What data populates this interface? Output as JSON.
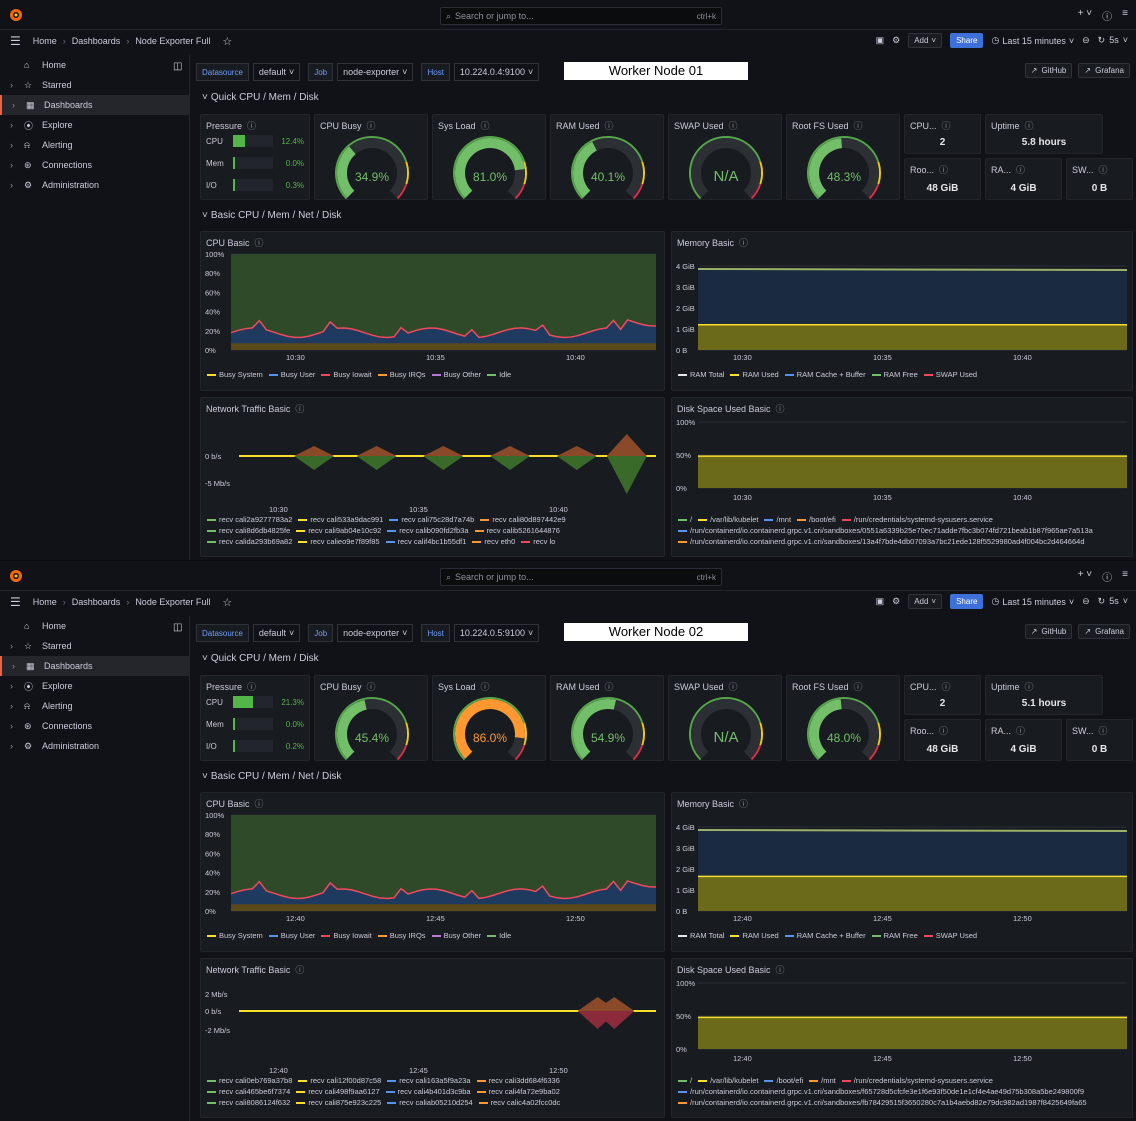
{
  "search": {
    "placeholder": "Search or jump to...",
    "shortcut": "ctrl+k"
  },
  "breadcrumb": [
    "Home",
    "Dashboards",
    "Node Exporter Full"
  ],
  "toolbar": {
    "add": "Add",
    "share": "Share",
    "time": "Last 15 minutes",
    "refresh": "5s"
  },
  "sidebar": [
    "Home",
    "Starred",
    "Dashboards",
    "Explore",
    "Alerting",
    "Connections",
    "Administration"
  ],
  "vars": {
    "datasource_label": "Datasource",
    "datasource": "default",
    "job_label": "Job",
    "job": "node-exporter",
    "host_label": "Host"
  },
  "links": {
    "github": "GitHub",
    "grafana": "Grafana"
  },
  "rows": {
    "quick": "Quick CPU / Mem / Disk",
    "basic": "Basic CPU / Mem / Net / Disk"
  },
  "panel_titles": {
    "pressure": "Pressure",
    "cpu_busy": "CPU Busy",
    "sys_load": "Sys Load",
    "ram_used": "RAM Used",
    "swap_used": "SWAP Used",
    "rootfs_used": "Root FS Used",
    "cpu_cores": "CPU...",
    "uptime": "Uptime",
    "rootfs_total": "Roo...",
    "ram_total": "RA...",
    "swap_total": "SW...",
    "cpu_basic": "CPU Basic",
    "mem_basic": "Memory Basic",
    "net_basic": "Network Traffic Basic",
    "disk_basic": "Disk Space Used Basic"
  },
  "pressure_labels": [
    "CPU",
    "Mem",
    "I/O"
  ],
  "cpu_legend": [
    "Busy System",
    "Busy User",
    "Busy Iowait",
    "Busy IRQs",
    "Busy Other",
    "Idle"
  ],
  "mem_legend": [
    "RAM Total",
    "RAM Used",
    "RAM Cache + Buffer",
    "RAM Free",
    "SWAP Used"
  ],
  "colors": {
    "green": "#73bf69",
    "yellow": "#fade2a",
    "blue": "#5794f2",
    "orange": "#ff9830",
    "red": "#f2495c",
    "purple": "#b877d9",
    "idle": "#56a64b"
  },
  "nodes": [
    {
      "host": "10.224.0.4:9100",
      "name": "Worker Node 01",
      "pressure": [
        12.4,
        0.0,
        0.3
      ],
      "pressure_text": [
        "12.4%",
        "0.0%",
        "0.3%"
      ],
      "gauges": {
        "cpu_busy": "34.9%",
        "sys_load": "81.0%",
        "ram_used": "40.1%",
        "swap_used": "N/A",
        "rootfs_used": "48.3%"
      },
      "gauge_values": {
        "cpu_busy": 34.9,
        "sys_load": 81.0,
        "ram_used": 40.1,
        "rootfs_used": 48.3
      },
      "stats": {
        "cpu_cores": "2",
        "uptime": "5.8 hours",
        "rootfs_total": "48 GiB",
        "ram_total": "4 GiB",
        "swap_total": "0 B"
      },
      "cpu_y": [
        "100%",
        "80%",
        "60%",
        "40%",
        "20%",
        "0%"
      ],
      "cpu_x": [
        "10:30",
        "10:35",
        "10:40"
      ],
      "mem_y": [
        "4 GiB",
        "3 GiB",
        "2 GiB",
        "1 GiB",
        "0 B"
      ],
      "mem_x": [
        "10:30",
        "10:35",
        "10:40"
      ],
      "net_y": [
        "0 b/s",
        "-5 Mb/s"
      ],
      "net_x": [
        "10:30",
        "10:35",
        "10:40"
      ],
      "disk_y": [
        "100%",
        "50%",
        "0%"
      ],
      "disk_x": [
        "10:30",
        "10:35",
        "10:40"
      ],
      "net_legend": [
        [
          "recv cali2a9277783a2",
          "recv cali533a9dac991",
          "recv cali75c28d7a74b",
          "recv cali80d897442e9"
        ],
        [
          "recv cali8d6db4825fe",
          "recv cali9ab04e10c92",
          "recv calib090fd2fb3a",
          "recv calib5261644876"
        ],
        [
          "recv calida293b69a82",
          "recv calieo9e7f89f85",
          "recv calif4bc1b55df1",
          "recv eth0",
          "recv lo"
        ]
      ],
      "disk_legend": [
        [
          "/",
          "/var/lib/kubelet",
          "/mnt",
          "/boot/efi",
          "/run/credentials/systemd-sysusers.service"
        ],
        [
          "/run/containerd/io.containerd.grpc.v1.cri/sandboxes/0551a6339b25e70ec71adde7fbc3b074fd721beab1b87f965ae7a513a"
        ],
        [
          "/run/containerd/io.containerd.grpc.v1.cri/sandboxes/13a4f7bde4db07093a7bc21ede128f5529980ad4f004bc2d464664d"
        ]
      ]
    },
    {
      "host": "10.224.0.5:9100",
      "name": "Worker Node 02",
      "pressure": [
        21.3,
        0.0,
        0.2
      ],
      "pressure_text": [
        "21.3%",
        "0.0%",
        "0.2%"
      ],
      "gauges": {
        "cpu_busy": "45.4%",
        "sys_load": "86.0%",
        "ram_used": "54.9%",
        "swap_used": "N/A",
        "rootfs_used": "48.0%"
      },
      "gauge_values": {
        "cpu_busy": 45.4,
        "sys_load": 86.0,
        "ram_used": 54.9,
        "rootfs_used": 48.0
      },
      "stats": {
        "cpu_cores": "2",
        "uptime": "5.1 hours",
        "rootfs_total": "48 GiB",
        "ram_total": "4 GiB",
        "swap_total": "0 B"
      },
      "cpu_y": [
        "100%",
        "80%",
        "60%",
        "40%",
        "20%",
        "0%"
      ],
      "cpu_x": [
        "12:40",
        "12:45",
        "12:50"
      ],
      "mem_y": [
        "4 GiB",
        "3 GiB",
        "2 GiB",
        "1 GiB",
        "0 B"
      ],
      "mem_x": [
        "12:40",
        "12:45",
        "12:50"
      ],
      "net_y": [
        "2 Mb/s",
        "0 b/s",
        "-2 Mb/s"
      ],
      "net_x": [
        "12:40",
        "12:45",
        "12:50"
      ],
      "disk_y": [
        "100%",
        "50%",
        "0%"
      ],
      "disk_x": [
        "12:40",
        "12:45",
        "12:50"
      ],
      "net_legend": [
        [
          "recv cali0eb769a37b8",
          "recv cali12f00d87c58",
          "recv cali163a5f9a23a",
          "recv cali3dd684f6336"
        ],
        [
          "recv cali465be6f7374",
          "recv cali498f9aa6127",
          "recv cali4b401d3c9ba",
          "recv cali4fa72e9ba02"
        ],
        [
          "recv cali8086124f632",
          "recv cali875e923c225",
          "recv caliab05210d254",
          "recv calic4a02fcc0dc"
        ]
      ],
      "disk_legend": [
        [
          "/",
          "/var/lib/kubelet",
          "/boot/efi",
          "/mnt",
          "/run/credentials/systemd-sysusers.service"
        ],
        [
          "/run/containerd/io.containerd.grpc.v1.cri/sandboxes/f65728d5cfcfe3e1f6e93f50de1e1cf4e4ae49d75b308a5be249800f9"
        ],
        [
          "/run/containerd/io.containerd.grpc.v1.cri/sandboxes/fb78429515f3650280c7a1b4aebd82e79dc982ad1987f8425649fa65"
        ]
      ]
    }
  ]
}
